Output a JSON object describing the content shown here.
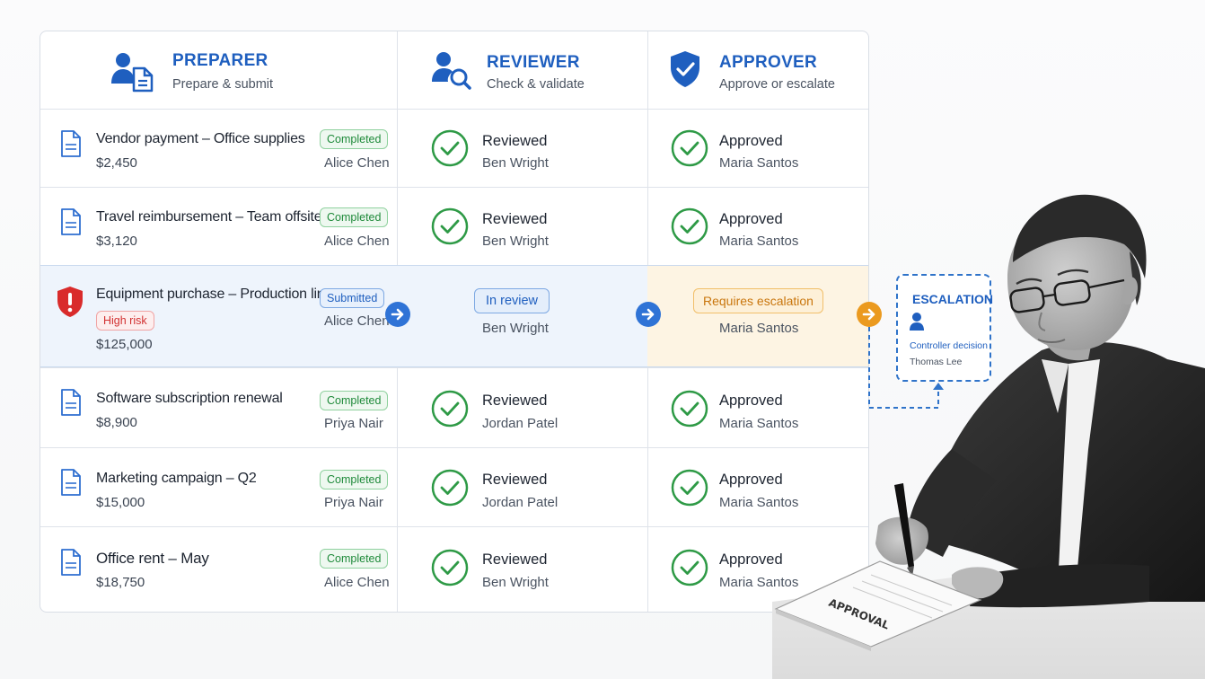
{
  "columns": [
    {
      "title": "PREPARER",
      "subtitle": "Prepare & submit"
    },
    {
      "title": "REVIEWER",
      "subtitle": "Check & validate"
    },
    {
      "title": "APPROVER",
      "subtitle": "Approve or escalate"
    }
  ],
  "rows": [
    {
      "title": "Vendor payment – Office supplies",
      "amount": "$2,450",
      "badge": "Completed",
      "preparer": "Alice Chen",
      "review_status": "Reviewed",
      "reviewer": "Ben Wright",
      "approval_status": "Approved",
      "approver": "Maria Santos"
    },
    {
      "title": "Travel reimbursement – Team offsite",
      "amount": "$3,120",
      "badge": "Completed",
      "preparer": "Alice Chen",
      "review_status": "Reviewed",
      "reviewer": "Ben Wright",
      "approval_status": "Approved",
      "approver": "Maria Santos"
    },
    {
      "title": "Equipment purchase – Production line",
      "risk": "High risk",
      "amount": "$125,000",
      "badge": "Submitted",
      "preparer": "Alice Chen",
      "review_status": "In review",
      "reviewer": "Ben Wright",
      "approval_status": "Requires escalation",
      "approver": "Maria Santos"
    },
    {
      "title": "Software subscription renewal",
      "amount": "$8,900",
      "badge": "Completed",
      "preparer": "Priya Nair",
      "review_status": "Reviewed",
      "reviewer": "Jordan Patel",
      "approval_status": "Approved",
      "approver": "Maria Santos"
    },
    {
      "title": "Marketing campaign – Q2",
      "amount": "$15,000",
      "badge": "Completed",
      "preparer": "Priya Nair",
      "review_status": "Reviewed",
      "reviewer": "Jordan Patel",
      "approval_status": "Approved",
      "approver": "Maria Santos"
    },
    {
      "title": "Office rent – May",
      "amount": "$18,750",
      "badge": "Completed",
      "preparer": "Alice Chen",
      "review_status": "Reviewed",
      "reviewer": "Ben Wright",
      "approval_status": "Approved",
      "approver": "Maria Santos"
    }
  ],
  "escalation": {
    "title": "ESCALATION",
    "label": "Controller decision",
    "name": "Thomas Lee"
  },
  "document_stamp": "APPROVAL",
  "colors": {
    "accent": "#1f5fbf",
    "success": "#1f8a3a",
    "risk": "#d23232",
    "escalation": "#e8951e"
  },
  "icons": {
    "preparer": "user-document-icon",
    "reviewer": "user-search-icon",
    "approver": "shield-check-icon",
    "row": "document-icon",
    "risk": "shield-alert-icon",
    "done": "check-circle-icon",
    "flow": "arrow-right-icon",
    "escalation": "user-icon"
  }
}
